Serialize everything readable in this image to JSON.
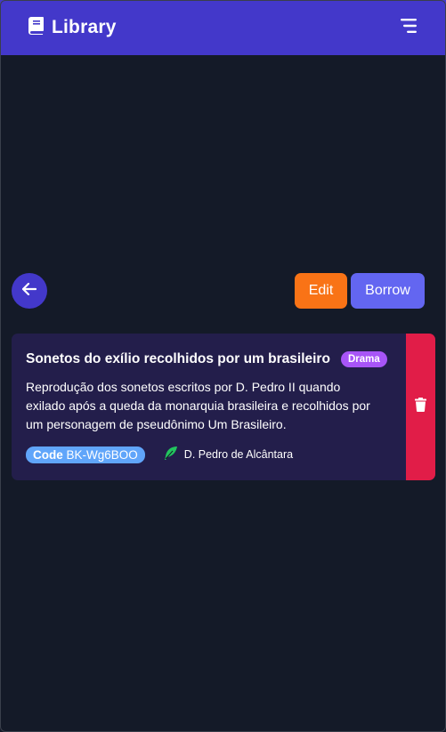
{
  "header": {
    "title": "Library",
    "logo_icon": "book-icon",
    "menu_icon": "menu-icon",
    "color": "#4338ca"
  },
  "actions": {
    "back_icon": "arrow-left-icon",
    "edit_label": "Edit",
    "borrow_label": "Borrow"
  },
  "book": {
    "title": "Sonetos do exílio recolhidos por um brasileiro",
    "genre": "Drama",
    "description": "Reprodução dos sonetos escritos por D. Pedro II quando exilado após a queda da monarquia brasileira e recolhidos por um personagem de pseudônimo Um Brasileiro.",
    "code_label": "Code",
    "code_value": "BK-Wg6BOO",
    "author": "D. Pedro de Alcântara",
    "author_icon": "feather-icon",
    "delete_icon": "trash-icon"
  },
  "colors": {
    "background": "#141a28",
    "card": "#231e4b",
    "edit": "#f97316",
    "borrow": "#6366f1",
    "genre_badge": "#a855f7",
    "code_badge": "#60a5fa",
    "delete": "#e11d48",
    "feather": "#22c55e"
  }
}
